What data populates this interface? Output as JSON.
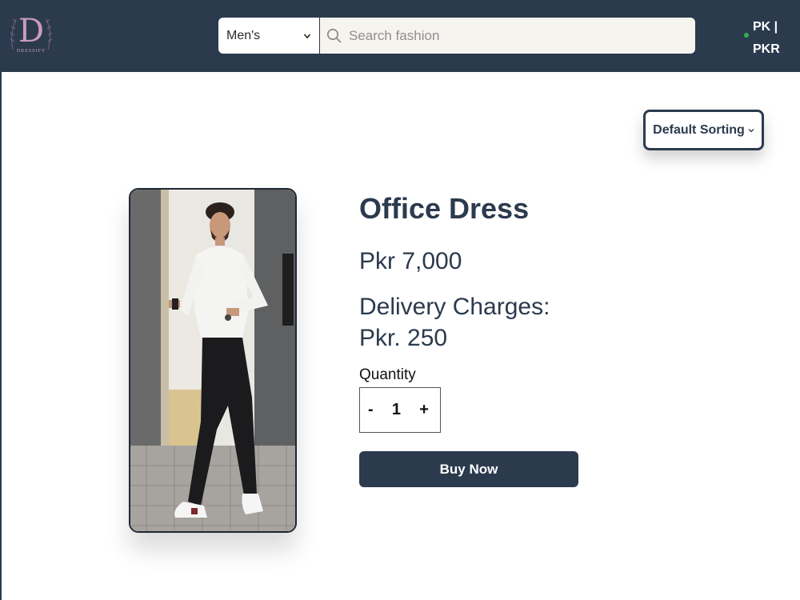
{
  "brand": {
    "logo_letter": "D",
    "logo_word": "DRESSIFY"
  },
  "header": {
    "category_selected": "Men's",
    "search_placeholder": "Search fashion",
    "locale_line1": "PK |",
    "locale_line2": "PKR"
  },
  "sort": {
    "label": "Default Sorting"
  },
  "product": {
    "title": "Office Dress",
    "price": "Pkr 7,000",
    "delivery_line1": "Delivery Charges:",
    "delivery_line2": "Pkr. 250",
    "quantity_label": "Quantity",
    "quantity_minus": "-",
    "quantity_value": "1",
    "quantity_plus": "+",
    "buy_label": "Buy Now",
    "image_subject": "man in white shirt and black trousers walking on a stone pavement"
  },
  "colors": {
    "header_bg": "#2c3a4e",
    "accent": "#2c3a4e",
    "logo": "#c99cc2",
    "status_dot": "#2fb24a"
  },
  "icons": [
    "search-icon",
    "chevron-down-icon",
    "logo-leaves-icon"
  ]
}
